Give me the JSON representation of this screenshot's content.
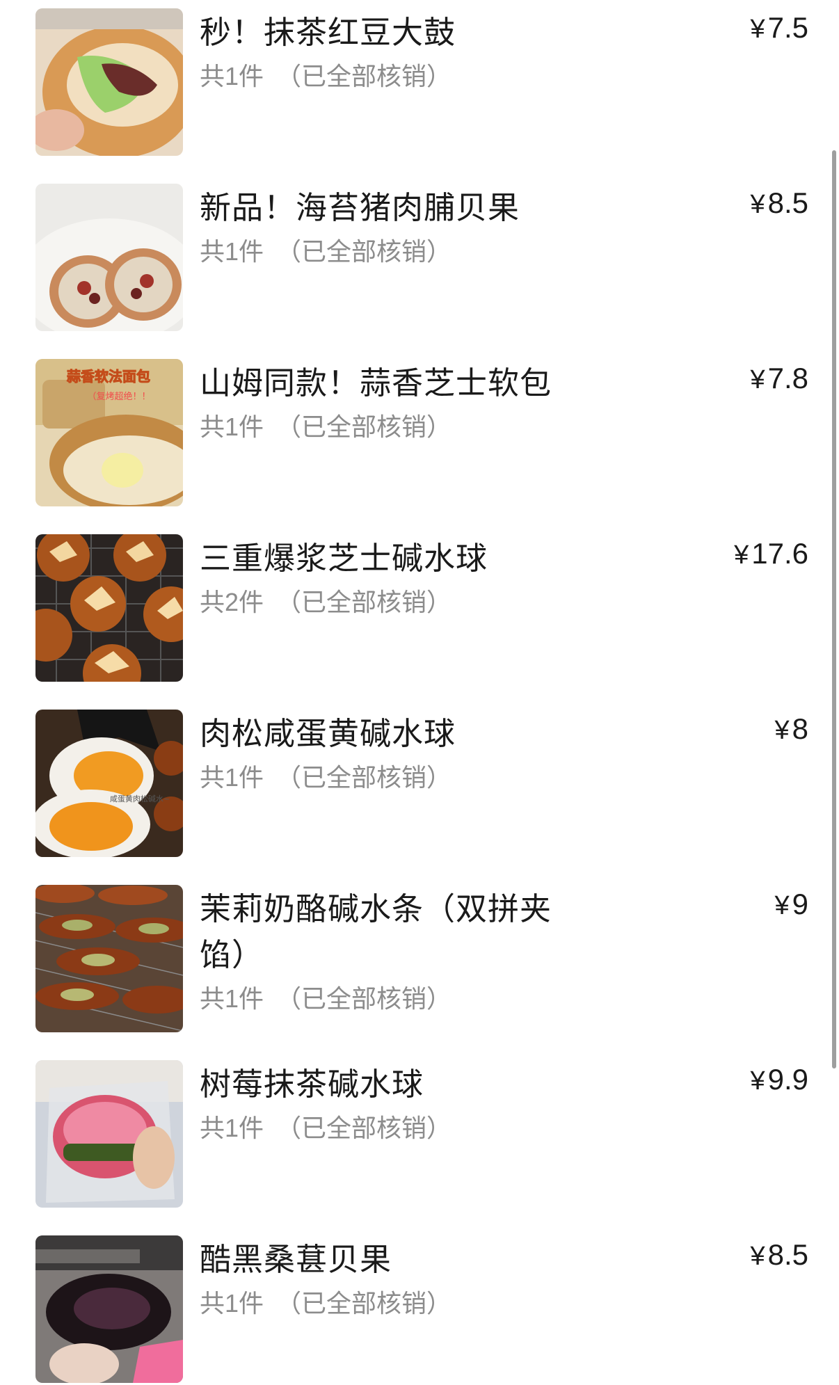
{
  "currency_symbol": "¥",
  "items": [
    {
      "title": "秒！抹茶红豆大鼓",
      "count": "共1件",
      "status": "（已全部核销）",
      "price": "7.5"
    },
    {
      "title": "新品！海苔猪肉脯贝果",
      "count": "共1件",
      "status": "（已全部核销）",
      "price": "8.5"
    },
    {
      "title": "山姆同款！蒜香芝士软包",
      "count": "共1件",
      "status": "（已全部核销）",
      "price": "7.8",
      "thumb_text": "蒜香软法面包",
      "thumb_text_2": "（复烤超绝！！"
    },
    {
      "title": "三重爆浆芝士碱水球",
      "count": "共2件",
      "status": "（已全部核销）",
      "price": "17.6"
    },
    {
      "title": "肉松咸蛋黄碱水球",
      "count": "共1件",
      "status": "（已全部核销）",
      "price": "8",
      "thumb_text": "咸蛋黄肉松碱水~"
    },
    {
      "title": "茉莉奶酪碱水条（双拼夹馅）",
      "count": "共1件",
      "status": "（已全部核销）",
      "price": "9"
    },
    {
      "title": "树莓抹茶碱水球",
      "count": "共1件",
      "status": "（已全部核销）",
      "price": "9.9"
    },
    {
      "title": "酷黑桑葚贝果",
      "count": "共1件",
      "status": "（已全部核销）",
      "price": "8.5"
    }
  ]
}
